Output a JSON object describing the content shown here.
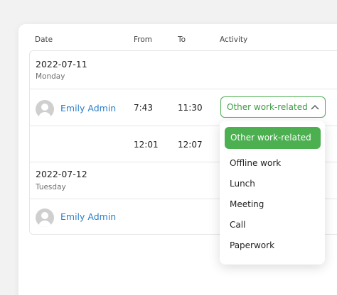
{
  "table": {
    "headers": {
      "date": "Date",
      "from": "From",
      "to": "To",
      "activity": "Activity"
    },
    "days": [
      {
        "date": "2022-07-11",
        "weekday": "Monday",
        "entries": [
          {
            "user": "Emily Admin",
            "from": "7:43",
            "to": "11:30",
            "activity": "Other work-related"
          },
          {
            "user": "",
            "from": "12:01",
            "to": "12:07",
            "activity": ""
          }
        ]
      },
      {
        "date": "2022-07-12",
        "weekday": "Tuesday",
        "entries": [
          {
            "user": "Emily Admin",
            "from": "",
            "to": "",
            "activity": ""
          }
        ]
      }
    ]
  },
  "activity_dropdown": {
    "expanded": true,
    "selected": "Other work-related",
    "options": [
      "Other work-related",
      "Offline work",
      "Lunch",
      "Meeting",
      "Call",
      "Paperwork"
    ]
  },
  "icons": {
    "avatar": "user-avatar-icon",
    "chevron": "chevron-up-icon"
  },
  "colors": {
    "accent": "#4caf50",
    "link": "#2a7fc9"
  }
}
